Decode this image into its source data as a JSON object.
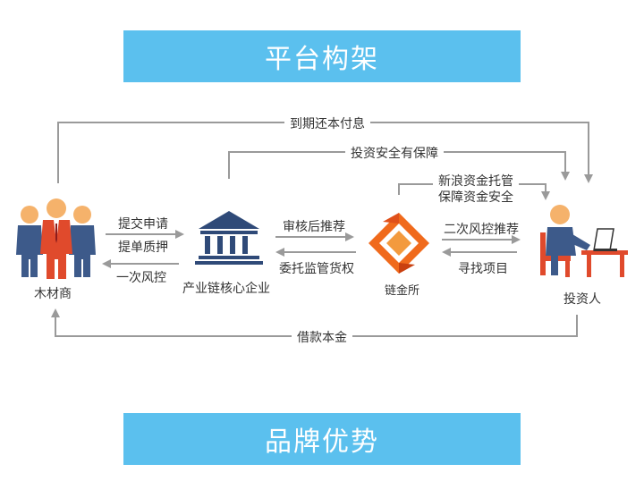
{
  "banners": {
    "top": "平台构架",
    "bottom": "品牌优势"
  },
  "nodes": {
    "supplier": "木材商",
    "core_enterprise": "产业链核心企业",
    "exchange": "链金所",
    "investor": "投资人"
  },
  "edges": {
    "repay": "到期还本付息",
    "investment_guarantee": "投资安全有保障",
    "sina_custody_1": "新浪资金托管",
    "sina_custody_2": "保障资金安全",
    "submit_application": "提交申请",
    "bill_pledge": "提单质押",
    "risk_control_1": "一次风控",
    "audit_recommend": "审核后推荐",
    "entrusted_supervision": "委托监管货权",
    "risk_control_2": "二次风控推荐",
    "find_project": "寻找项目",
    "loan_principal": "借款本金"
  },
  "colors": {
    "banner": "#5bc0ee",
    "line": "#9a9a9a",
    "suit_blue": "#3d5a8a",
    "suit_red": "#e04a2c",
    "bank_navy": "#2f4a78",
    "logo_orange": "#f06a1c",
    "investor_blue": "#3d5a8a",
    "desk_red": "#e04a2c"
  }
}
